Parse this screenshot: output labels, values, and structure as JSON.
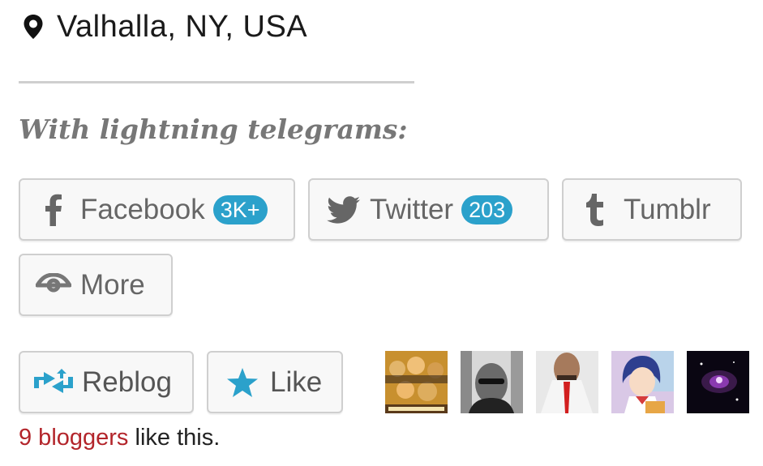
{
  "location": {
    "icon": "map-pin-icon",
    "text": "Valhalla, NY, USA"
  },
  "share": {
    "heading": "With lightning telegrams:",
    "buttons": {
      "facebook": {
        "icon": "facebook-icon",
        "label": "Facebook",
        "count": "3K+"
      },
      "twitter": {
        "icon": "twitter-icon",
        "label": "Twitter",
        "count": "203"
      },
      "tumblr": {
        "icon": "tumblr-icon",
        "label": "Tumblr"
      },
      "more": {
        "icon": "more-share-icon",
        "label": "More"
      }
    }
  },
  "likes": {
    "reblog": {
      "icon": "reblog-icon",
      "label": "Reblog"
    },
    "like": {
      "icon": "star-icon",
      "label": "Like"
    },
    "summary_link": "9 bloggers",
    "summary_rest": " like this."
  },
  "colors": {
    "badge": "#2ba1cb",
    "accent_blue": "#2ba1cb",
    "link_red": "#b3252b",
    "heading_gray": "#777777"
  }
}
